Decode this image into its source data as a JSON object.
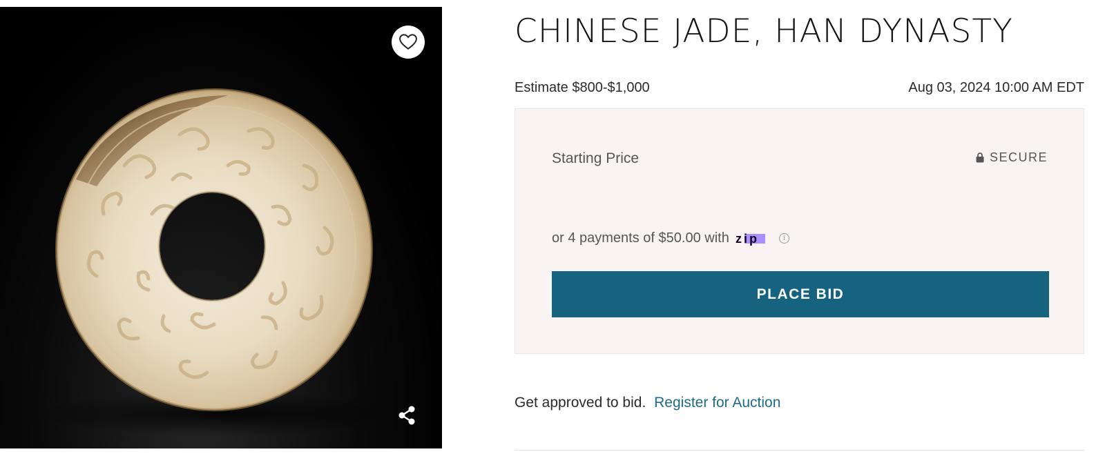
{
  "lot": {
    "title": "CHINESE JADE, HAN DYNASTY",
    "estimate": "Estimate $800-$1,000",
    "auction_datetime": "Aug 03, 2024 10:00 AM EDT"
  },
  "image": {
    "favorite_icon": "heart-outline-icon",
    "share_icon": "share-icon",
    "background": "#000000"
  },
  "bid_card": {
    "starting_price_label": "Starting Price",
    "secure_label": "SECURE",
    "secure_icon": "lock-icon",
    "installments_text": "or 4 payments of $50.00 with",
    "zip_logo_text": "zip",
    "info_icon_text": "i",
    "place_bid_label": "PLACE BID"
  },
  "approval": {
    "prompt": "Get approved to bid.",
    "register_link": "Register for Auction"
  },
  "colors": {
    "accent": "#15637e",
    "link": "#1e6a86",
    "card_background": "#f9f4f4",
    "zip_purple": "#aa8fff"
  }
}
